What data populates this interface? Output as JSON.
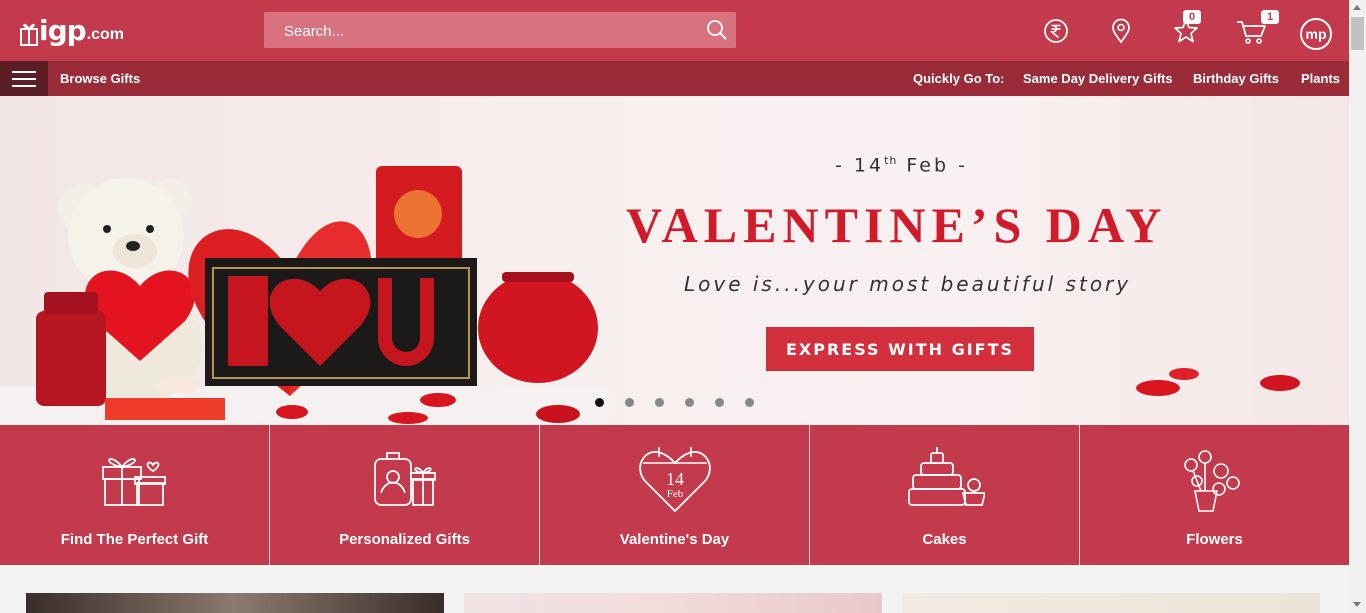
{
  "header": {
    "logo_mark": "igp",
    "logo_suffix": ".com",
    "search_placeholder": "Search...",
    "wishlist_count": "0",
    "cart_count": "1",
    "avatar_initials": "mp"
  },
  "nav": {
    "browse_label": "Browse Gifts",
    "quick_label": "Quickly Go To:",
    "links": [
      "Same Day Delivery Gifts",
      "Birthday Gifts",
      "Plants"
    ]
  },
  "hero": {
    "date_prefix": "- 14",
    "date_sup": "th",
    "date_suffix": " Feb -",
    "title": "VALENTINE’S DAY",
    "tagline": "Love is...your most beautiful story",
    "cta": "EXPRESS WITH GIFTS",
    "slides_total": 6,
    "slide_active": 1
  },
  "categories": [
    {
      "label": "Find The Perfect Gift",
      "icon": "gift-icon"
    },
    {
      "label": "Personalized Gifts",
      "icon": "personalized-gift-icon"
    },
    {
      "label": "Valentine's Day",
      "icon": "heart-calendar-icon",
      "icon_day": "14",
      "icon_month": "Feb"
    },
    {
      "label": "Cakes",
      "icon": "cake-icon"
    },
    {
      "label": "Flowers",
      "icon": "flowers-icon"
    }
  ],
  "colors": {
    "brand": "#c23a4b",
    "nav": "#9a2b38",
    "cta": "#d32f3c",
    "title_red": "#d11a2a"
  }
}
